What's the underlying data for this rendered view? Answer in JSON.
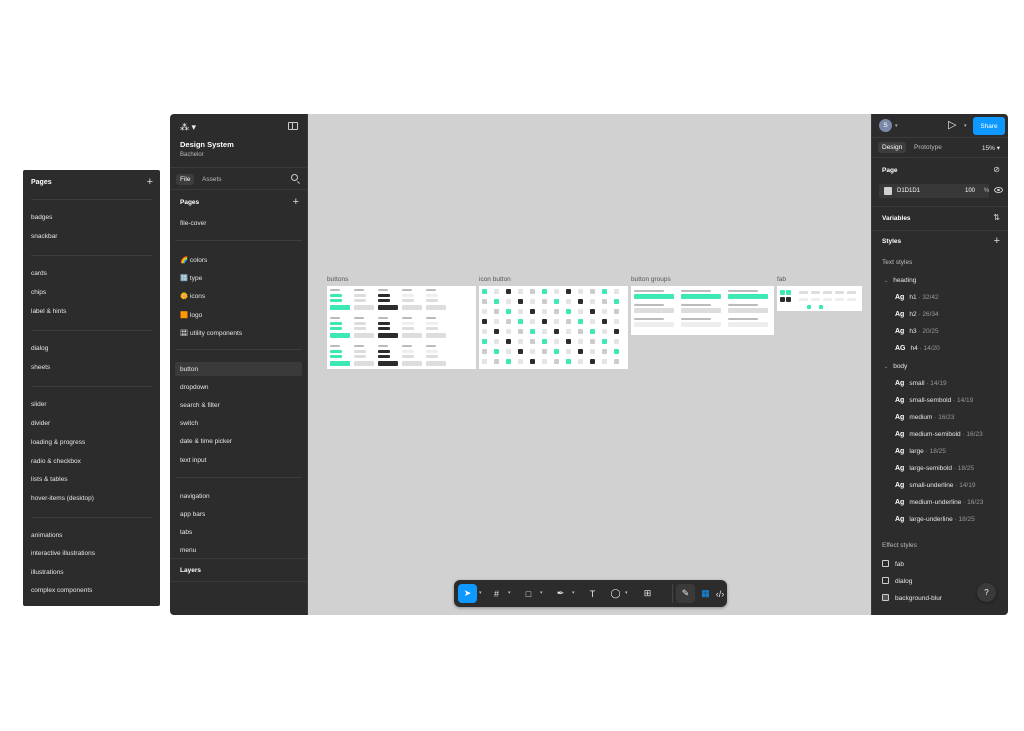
{
  "standalone_pages": {
    "header": "Pages",
    "items": [
      "badges",
      "snackbar",
      "cards",
      "chips",
      "label & hints",
      "dialog",
      "sheets",
      "slider",
      "divider",
      "loading & progress",
      "radio & checkbox",
      "lists & tables",
      "hover-items (desktop)",
      "animations",
      "interactive illustrations",
      "illustrations",
      "complex components"
    ]
  },
  "left_panel": {
    "project_title": "Design System",
    "project_sub": "Bachelor",
    "tabs": [
      "File",
      "Assets"
    ],
    "pages_header": "Pages",
    "pages": [
      "file-cover",
      "🌈 colors",
      "🔠 type",
      "🌼 icons",
      "🟧 logo",
      "🎛 utility components",
      "button",
      "dropdown",
      "search & filter",
      "switch",
      "date & time picker",
      "text input",
      "navigation",
      "app bars",
      "tabs",
      "menu"
    ],
    "layers_header": "Layers"
  },
  "canvas": {
    "frames": [
      "buttons",
      "icon button",
      "button groups",
      "fab"
    ],
    "accent": "#3ee8b5",
    "dark": "#2c2c2c"
  },
  "toolbar": {
    "tools": [
      "move-icon",
      "frame-icon",
      "rectangle-icon",
      "pen-icon",
      "text-icon",
      "comment-icon",
      "components-icon",
      "draw-icon",
      "dev-mode-icon",
      "code-icon"
    ]
  },
  "right_panel": {
    "avatar_letter": "S",
    "share_label": "Share",
    "tabs": [
      "Design",
      "Prototype"
    ],
    "zoom": "15%",
    "page_header": "Page",
    "page_color": "D1D1D1",
    "page_opacity": "100",
    "page_opacity_unit": "%",
    "variables_header": "Variables",
    "styles_header": "Styles",
    "text_styles_header": "Text styles",
    "heading_group": "heading",
    "heading_styles": [
      {
        "ag": "Ag",
        "name": "h1",
        "meta": " · 32/42"
      },
      {
        "ag": "Ag",
        "name": "h2",
        "meta": " · 26/34"
      },
      {
        "ag": "Ag",
        "name": "h3",
        "meta": " · 20/25"
      },
      {
        "ag": "AG",
        "name": "h4",
        "meta": " · 14/20"
      }
    ],
    "body_group": "body",
    "body_styles": [
      {
        "ag": "Ag",
        "name": "small",
        "meta": " · 14/19"
      },
      {
        "ag": "Ag",
        "name": "small-sembold",
        "meta": " · 14/19"
      },
      {
        "ag": "Ag",
        "name": "medium",
        "meta": " · 16/23"
      },
      {
        "ag": "Ag",
        "name": "medium-semibold",
        "meta": " · 16/23"
      },
      {
        "ag": "Ag",
        "name": "large",
        "meta": " · 18/25"
      },
      {
        "ag": "Ag",
        "name": "large-semibold",
        "meta": " · 18/25"
      },
      {
        "ag": "Ag",
        "name": "small-underline",
        "meta": " · 14/19"
      },
      {
        "ag": "Ag",
        "name": "medium-underline",
        "meta": " · 16/23"
      },
      {
        "ag": "Ag",
        "name": "large-underline",
        "meta": " · 18/25"
      }
    ],
    "effect_styles_header": "Effect styles",
    "effect_styles": [
      "fab",
      "dialog",
      "background-blur"
    ],
    "help_label": "?"
  }
}
